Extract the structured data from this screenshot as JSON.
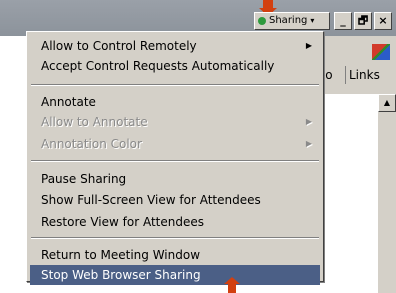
{
  "toolbar": {
    "sharing_label": "Sharing",
    "sharing_caret": "▾",
    "minimize": "_",
    "restore": "🗗",
    "close": "×"
  },
  "browser": {
    "go_label": "Go",
    "links_label": "Links"
  },
  "menu": {
    "items": [
      {
        "label": "Allow to Control Remotely",
        "submenu": true,
        "disabled": false
      },
      {
        "label": "Accept Control Requests Automatically",
        "disabled": false
      },
      {
        "label": "Annotate",
        "disabled": false
      },
      {
        "label": "Allow to Annotate",
        "submenu": true,
        "disabled": true
      },
      {
        "label": "Annotation Color",
        "submenu": true,
        "disabled": true
      },
      {
        "label": "Pause Sharing",
        "disabled": false
      },
      {
        "label": "Show Full-Screen View for Attendees",
        "disabled": false
      },
      {
        "label": "Restore View for Attendees",
        "disabled": false
      },
      {
        "label": "Return to Meeting Window",
        "disabled": false
      },
      {
        "label": "Stop Web Browser Sharing",
        "disabled": false,
        "selected": true
      }
    ],
    "submenu_glyph": "▶"
  },
  "colors": {
    "menu_bg": "#d4d0c8",
    "selection": "#4b5f86",
    "callout_arrow": "#d24010",
    "sharing_dot": "#2e9a3e"
  },
  "icons": [
    "sharing-status-icon",
    "submenu-arrow-icon",
    "callout-arrow-icon",
    "browser-logo-icon",
    "scroll-up-arrow-icon"
  ]
}
